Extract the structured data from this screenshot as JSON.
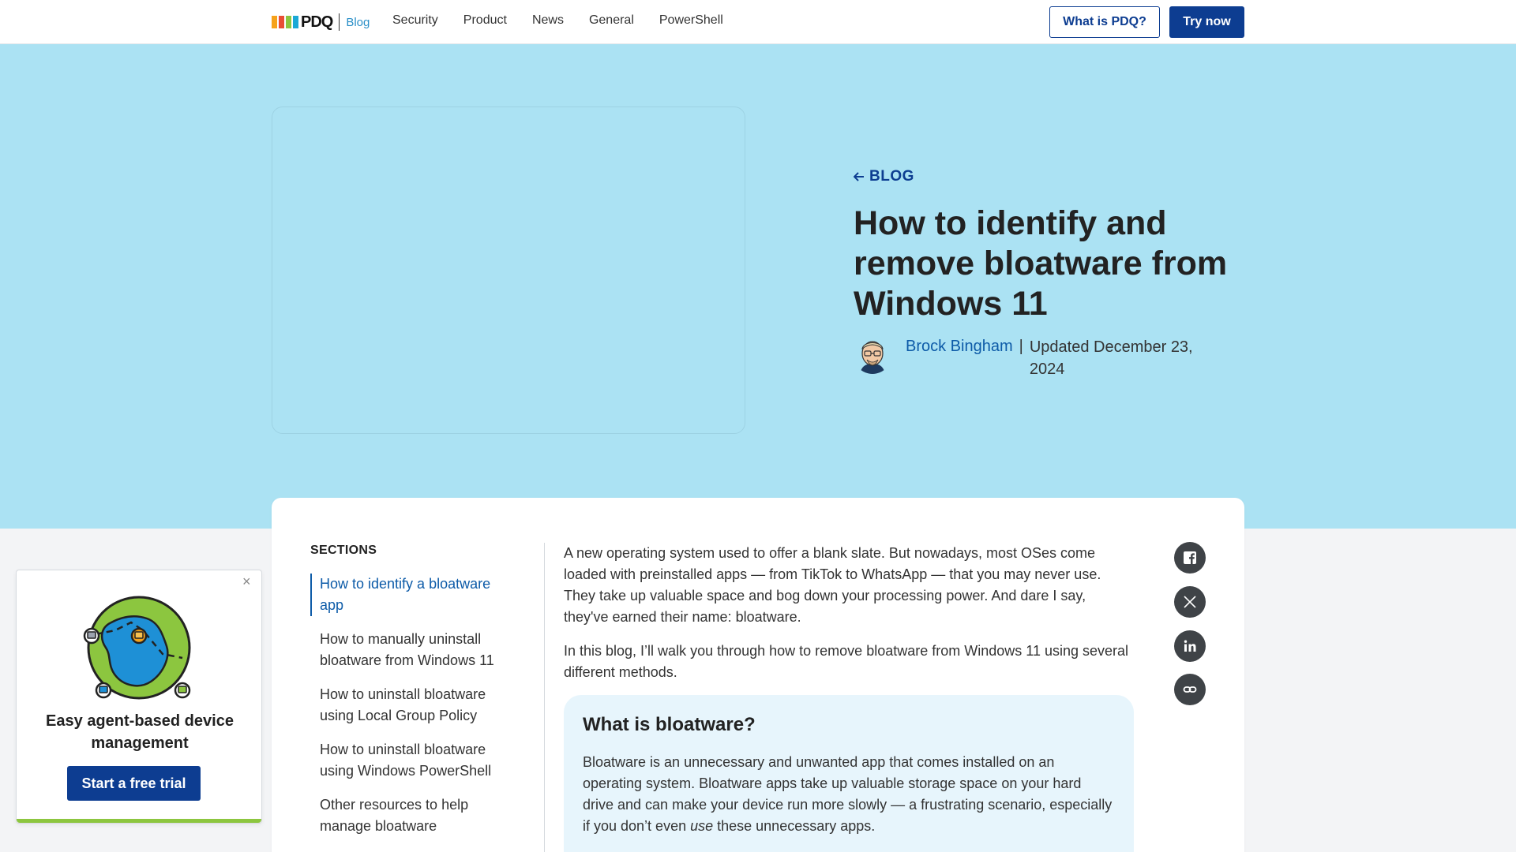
{
  "header": {
    "logo_text": "PDQ",
    "logo_sub": "Blog",
    "nav": [
      "Security",
      "Product",
      "News",
      "General",
      "PowerShell"
    ],
    "what_is_label": "What is PDQ?",
    "try_label": "Try now"
  },
  "hero": {
    "back_label": "BLOG",
    "title": "How to identify and remove bloatware from Windows 11",
    "author": "Brock Bingham",
    "separator": "|",
    "updated": "Updated December 23, 2024"
  },
  "sections": {
    "heading": "SECTIONS",
    "items": [
      "How to identify a bloatware app",
      "How to manually uninstall bloatware from Windows 11",
      "How to uninstall bloatware using Local Group Policy",
      "How to uninstall bloatware using Windows PowerShell",
      "Other resources to help manage bloatware"
    ]
  },
  "article": {
    "p1": "A new operating system used to offer a blank slate. But nowadays, most OSes come loaded with preinstalled apps — from TikTok to WhatsApp — that you may never use. They take up valuable space and bog down your processing power. And dare I say, they've earned their name: bloatware.",
    "p2": "In this blog, I’ll walk you through how to remove bloatware from Windows 11 using several different methods.",
    "callout_title": "What is bloatware?",
    "callout_p_before": "Bloatware is an unnecessary and unwanted app that comes installed on an operating system. Bloatware apps take up valuable storage space on your hard drive and can make your device run more slowly — a frustrating scenario, especially if you don’t even ",
    "callout_p_em": "use",
    "callout_p_after": " these unnecessary apps."
  },
  "share": [
    "facebook-icon",
    "x-icon",
    "linkedin-icon",
    "link-icon"
  ],
  "promo": {
    "title": "Easy agent-based device management",
    "button": "Start a free trial",
    "close": "×"
  },
  "colors": {
    "brand": "#0d3d91",
    "hero_bg": "#abe2f3",
    "link": "#0d5ba8",
    "callout_bg": "#e7f5fc",
    "promo_accent": "#8cc63f"
  }
}
